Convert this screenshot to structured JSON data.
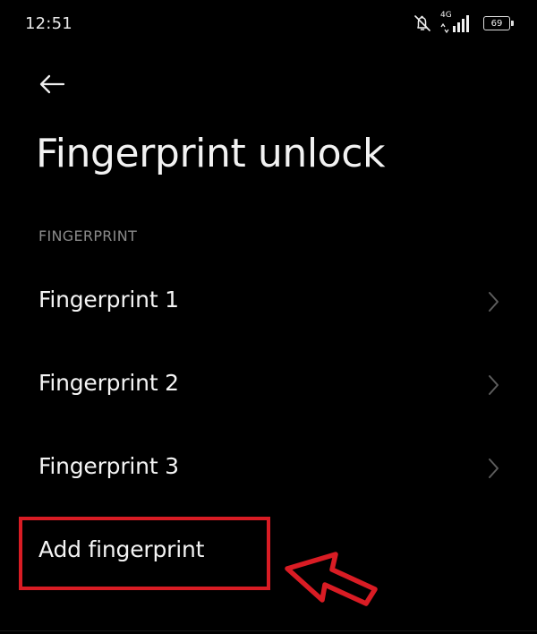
{
  "status_bar": {
    "time": "12:51",
    "network": "4G",
    "battery_level": "69",
    "icons": [
      "muted-bell-icon",
      "mobile-signal-icon",
      "battery-icon"
    ]
  },
  "navigation": {
    "back_icon": "back-arrow-icon"
  },
  "page": {
    "title": "Fingerprint unlock",
    "section_label": "FINGERPRINT"
  },
  "fingerprints": [
    {
      "label": "Fingerprint 1",
      "icon": "chevron-right-icon"
    },
    {
      "label": "Fingerprint 2",
      "icon": "chevron-right-icon"
    },
    {
      "label": "Fingerprint 3",
      "icon": "chevron-right-icon"
    }
  ],
  "actions": {
    "add_fingerprint": "Add fingerprint"
  },
  "annotation": {
    "highlight_color": "#d91c24",
    "arrow_icon": "annotation-arrow-icon"
  },
  "colors": {
    "background": "#000000",
    "text": "#f4f4f4",
    "secondary_text": "#8a8a8a",
    "chevron": "#5c5c5c",
    "highlight": "#d91c24"
  }
}
